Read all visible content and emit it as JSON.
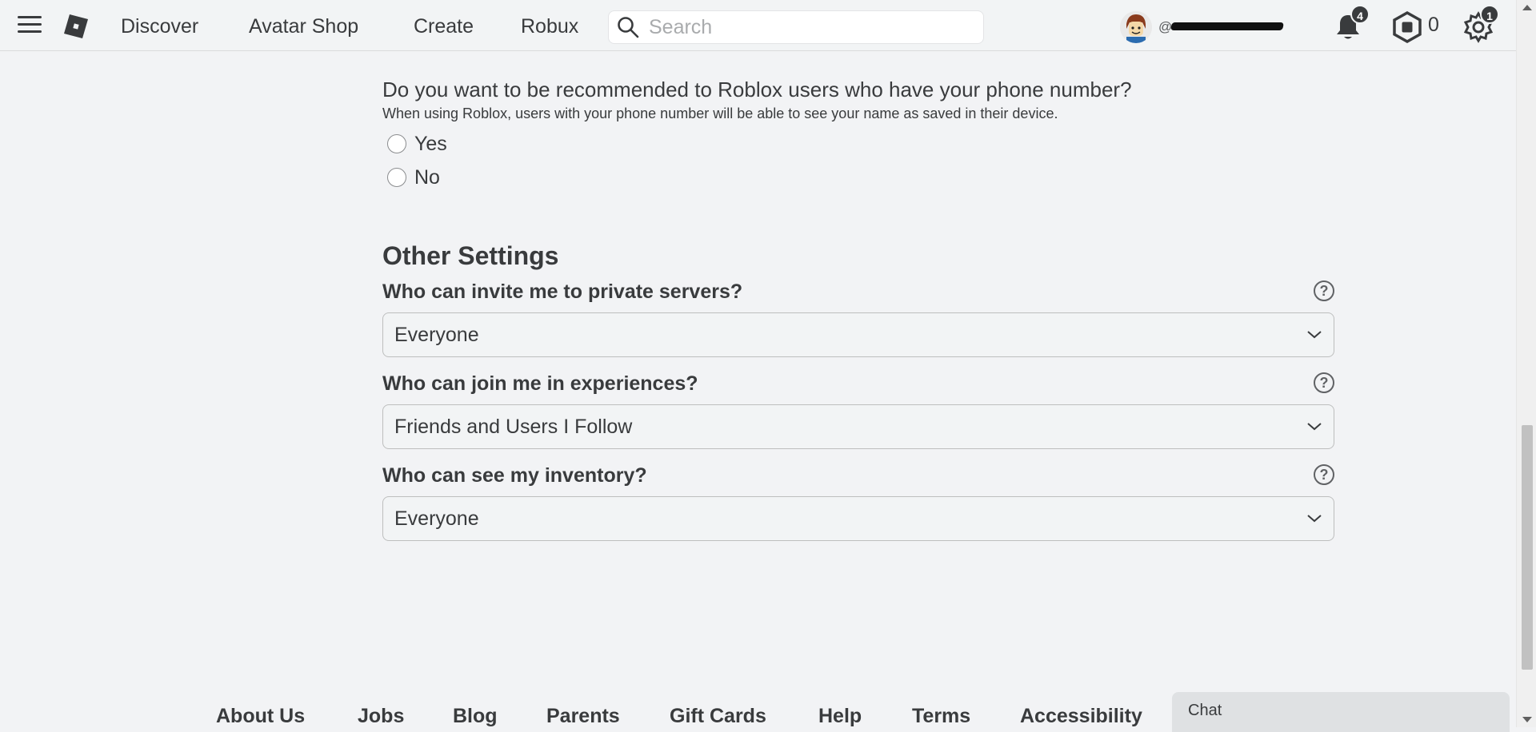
{
  "nav": {
    "links": [
      "Discover",
      "Avatar Shop",
      "Create",
      "Robux"
    ],
    "search_placeholder": "Search",
    "username_prefix": "@",
    "notifications_count": "4",
    "robux_balance": "0",
    "settings_badge": "1"
  },
  "recommend": {
    "question": "Do you want to be recommended to Roblox users who have your phone number?",
    "subtext": "When using Roblox, users with your phone number will be able to see your name as saved in their device.",
    "options": [
      "Yes",
      "No"
    ]
  },
  "other_settings": {
    "title": "Other Settings",
    "items": [
      {
        "label": "Who can invite me to private servers?",
        "value": "Everyone"
      },
      {
        "label": "Who can join me in experiences?",
        "value": "Friends and Users I Follow"
      },
      {
        "label": "Who can see my inventory?",
        "value": "Everyone"
      }
    ],
    "help_glyph": "?"
  },
  "footer": {
    "links": [
      "About Us",
      "Jobs",
      "Blog",
      "Parents",
      "Gift Cards",
      "Help",
      "Terms",
      "Accessibility"
    ]
  },
  "chat": {
    "label": "Chat"
  },
  "colors": {
    "text": "#393b3d",
    "background": "#f2f3f5",
    "border": "#bdbebe"
  }
}
